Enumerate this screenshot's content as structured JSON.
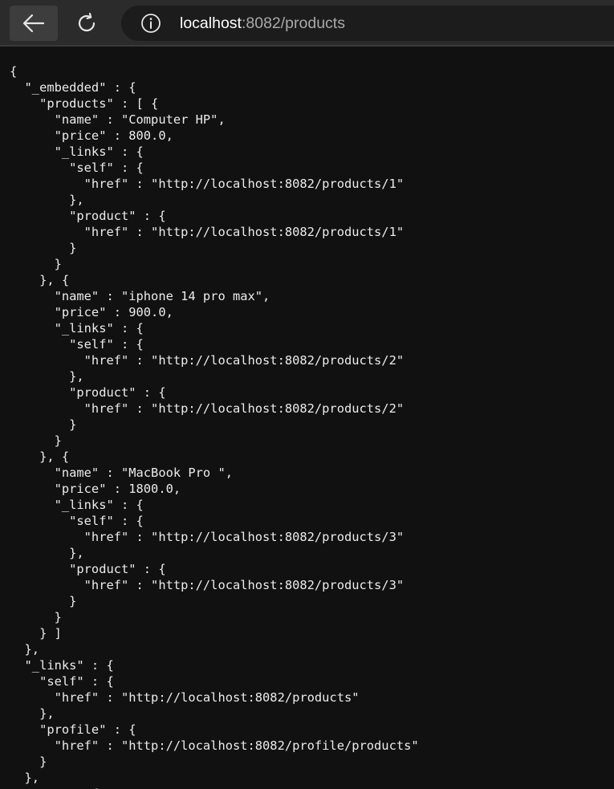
{
  "browser": {
    "url_host": "localhost",
    "url_rest": ":8082/products",
    "back_icon": "arrow-left-icon",
    "refresh_icon": "refresh-icon",
    "info_icon": "info-icon"
  },
  "json_lines": [
    "{",
    "  \"_embedded\" : {",
    "    \"products\" : [ {",
    "      \"name\" : \"Computer HP\",",
    "      \"price\" : 800.0,",
    "      \"_links\" : {",
    "        \"self\" : {",
    "          \"href\" : \"http://localhost:8082/products/1\"",
    "        },",
    "        \"product\" : {",
    "          \"href\" : \"http://localhost:8082/products/1\"",
    "        }",
    "      }",
    "    }, {",
    "      \"name\" : \"iphone 14 pro max\",",
    "      \"price\" : 900.0,",
    "      \"_links\" : {",
    "        \"self\" : {",
    "          \"href\" : \"http://localhost:8082/products/2\"",
    "        },",
    "        \"product\" : {",
    "          \"href\" : \"http://localhost:8082/products/2\"",
    "        }",
    "      }",
    "    }, {",
    "      \"name\" : \"MacBook Pro \",",
    "      \"price\" : 1800.0,",
    "      \"_links\" : {",
    "        \"self\" : {",
    "          \"href\" : \"http://localhost:8082/products/3\"",
    "        },",
    "        \"product\" : {",
    "          \"href\" : \"http://localhost:8082/products/3\"",
    "        }",
    "      }",
    "    } ]",
    "  },",
    "  \"_links\" : {",
    "    \"self\" : {",
    "      \"href\" : \"http://localhost:8082/products\"",
    "    },",
    "    \"profile\" : {",
    "      \"href\" : \"http://localhost:8082/profile/products\"",
    "    }",
    "  },",
    "  \"page\" : {"
  ]
}
